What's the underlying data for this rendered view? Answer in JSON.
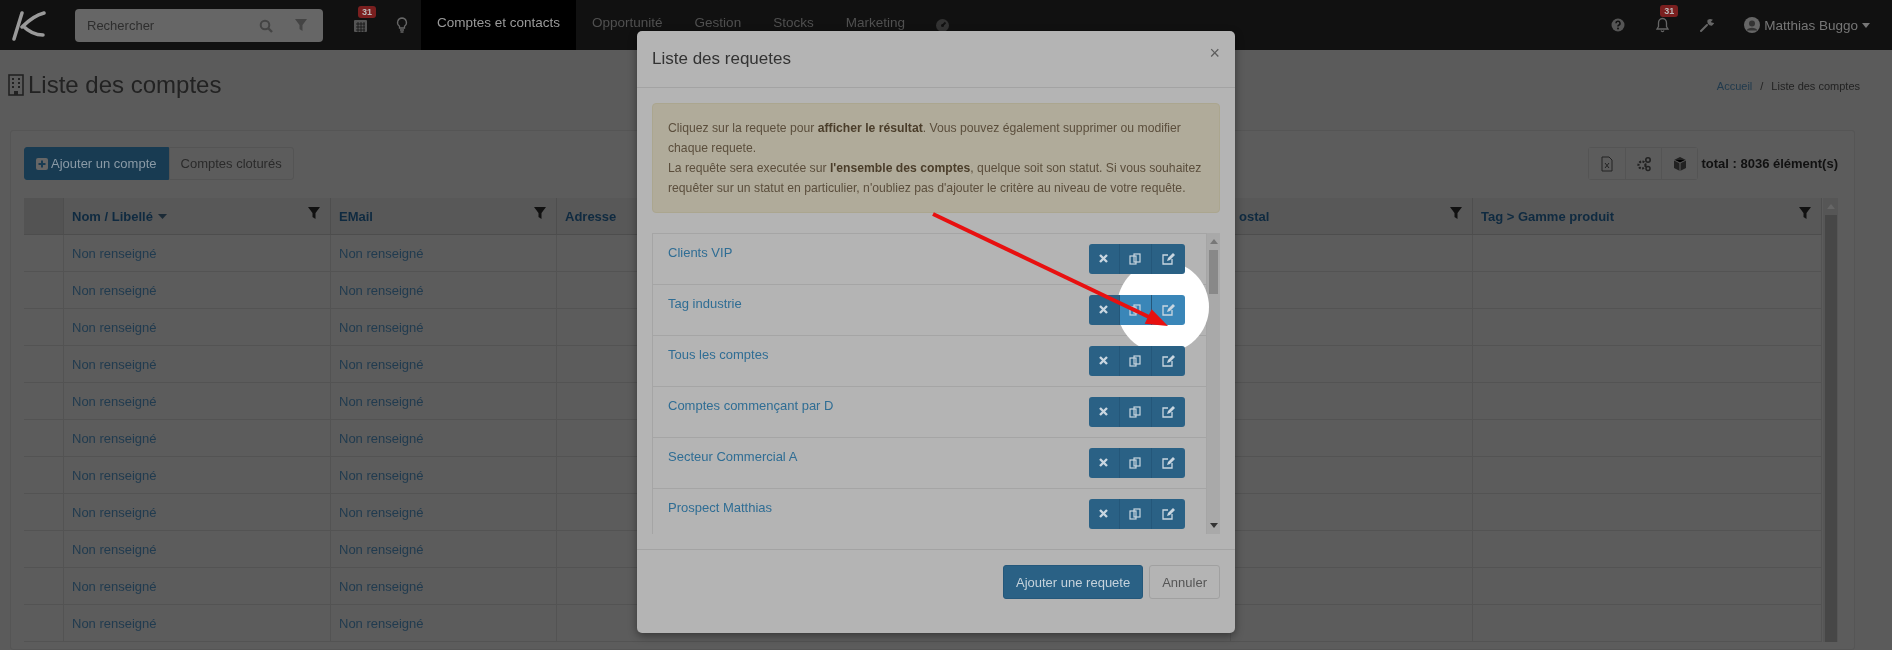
{
  "topbar": {
    "search": {
      "placeholder": "Rechercher"
    },
    "calendar_badge": "31",
    "nav": [
      {
        "label": "Comptes et contacts",
        "selected": true
      },
      {
        "label": "Opportunité",
        "selected": false
      },
      {
        "label": "Gestion",
        "selected": false
      },
      {
        "label": "Stocks",
        "selected": false
      },
      {
        "label": "Marketing",
        "selected": false
      }
    ],
    "notifications_badge": "31",
    "user": {
      "name": "Matthias Buggo"
    }
  },
  "page": {
    "title": "Liste des comptes",
    "breadcrumb": {
      "items": [
        "Accueil",
        "Liste des comptes"
      ],
      "separator": "/"
    }
  },
  "toolbar": {
    "buttons": [
      {
        "label": "Ajouter un compte",
        "kind": "primary"
      },
      {
        "label": "Comptes cloturés",
        "kind": "default"
      }
    ],
    "total": "total : 8036 élément(s)"
  },
  "table": {
    "columns": [
      {
        "label": "Nom / Libellé",
        "sorted": true,
        "filter": true
      },
      {
        "label": "EMail",
        "sorted": false,
        "filter": true
      },
      {
        "label": "Adresse",
        "sorted": false
      },
      {
        "label": "ostal",
        "sorted": false,
        "filter": true
      },
      {
        "label": "Tag > Gamme produit",
        "sorted": false,
        "filter": true
      }
    ],
    "rows": [
      [
        "Non renseigné",
        "Non renseigné"
      ],
      [
        "Non renseigné",
        "Non renseigné"
      ],
      [
        "Non renseigné",
        "Non renseigné"
      ],
      [
        "Non renseigné",
        "Non renseigné"
      ],
      [
        "Non renseigné",
        "Non renseigné"
      ],
      [
        "Non renseigné",
        "Non renseigné"
      ],
      [
        "Non renseigné",
        "Non renseigné"
      ],
      [
        "Non renseigné",
        "Non renseigné"
      ],
      [
        "Non renseigné",
        "Non renseigné"
      ],
      [
        "Non renseigné",
        "Non renseigné"
      ],
      [
        "Non renseigné",
        "Non renseigné"
      ]
    ]
  },
  "modal": {
    "title": "Liste des requetes",
    "close": "×",
    "info": [
      "Cliquez sur la requete pour **afficher le résultat**. Vous pouvez également supprimer ou modifier chaque requete.",
      "La requête sera executée sur **l'ensemble des comptes**, quelque soit son statut. Si vous souhaitez requêter sur un statut en particulier, n'oubliez pas d'ajouter le critère au niveau de votre requête."
    ],
    "queries": [
      {
        "label": "Clients VIP",
        "highlighted": false
      },
      {
        "label": "Tag industrie",
        "highlighted": true
      },
      {
        "label": "Tous les comptes",
        "highlighted": false
      },
      {
        "label": "Comptes commençant par D",
        "highlighted": false
      },
      {
        "label": "Secteur Commercial A",
        "highlighted": false
      },
      {
        "label": "Prospect Matthias",
        "highlighted": false
      }
    ],
    "buttons": [
      {
        "label": "Ajouter une requete",
        "kind": "primary"
      },
      {
        "label": "Annuler",
        "kind": "default"
      }
    ]
  }
}
